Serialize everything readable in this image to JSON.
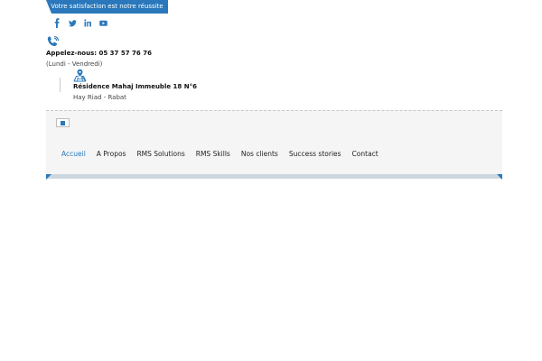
{
  "top_banner": {
    "slogan": "Votre satisfaction est notre réussite"
  },
  "social": [
    {
      "name": "facebook-icon",
      "glyph": "f"
    },
    {
      "name": "twitter-icon",
      "glyph": "t"
    },
    {
      "name": "linkedin-icon",
      "glyph": "in"
    },
    {
      "name": "youtube-icon",
      "glyph": "yt"
    }
  ],
  "contact": {
    "phone": "Appelez-nous: 05 37 57 76 76",
    "hours": "(Lundi - Vendredi)"
  },
  "address": {
    "line1": "Résidence Mahaj Immeuble 18 N°6",
    "line2": "Hay Riad - Rabat"
  },
  "nav": {
    "items": [
      {
        "label": "Accueil",
        "active": true
      },
      {
        "label": "A Propos",
        "active": false
      },
      {
        "label": "RMS Solutions",
        "active": false
      },
      {
        "label": "RMS Skills",
        "active": false
      },
      {
        "label": "Nos clients",
        "active": false
      },
      {
        "label": "Success stories",
        "active": false
      },
      {
        "label": "Contact",
        "active": false
      }
    ]
  },
  "colors": {
    "accent": "#2a78bb",
    "panel": "#f5f5f5",
    "bar": "#cdd7df"
  }
}
